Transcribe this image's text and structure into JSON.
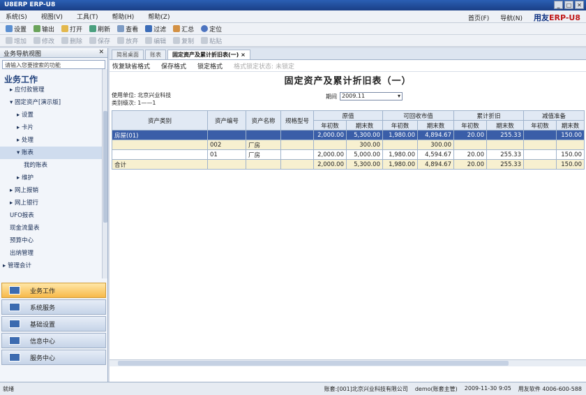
{
  "window": {
    "title": "U8ERP ERP-U8"
  },
  "menu": [
    "系统(S)",
    "视图(V)",
    "工具(T)",
    "帮助(H)",
    "帮助(Z)"
  ],
  "menu_right": {
    "home": "首页(F)",
    "nav": "导航(N)",
    "brand_prefix": "用友",
    "brand": "ERP-U8"
  },
  "toolbar1": [
    "设置",
    "输出",
    "打开",
    "刷新",
    "查看",
    "过滤",
    "汇总",
    "定位"
  ],
  "toolbar2": [
    "增加",
    "修改",
    "删除",
    "保存",
    "放弃",
    "编辑",
    "复制",
    "粘贴"
  ],
  "sidebar": {
    "header": "业务导航视图",
    "search_placeholder": "请输入您要搜索的功能",
    "section_title": "业务工作",
    "tree": [
      {
        "label": "▸ 应付款管理",
        "indent": 1
      },
      {
        "label": "▾ 固定资产[演示版]",
        "indent": 1
      },
      {
        "label": "▸ 设置",
        "indent": 2
      },
      {
        "label": "▸ 卡片",
        "indent": 2
      },
      {
        "label": "▸ 处理",
        "indent": 2
      },
      {
        "label": "▾ 账表",
        "indent": 2
      },
      {
        "label": "我的账表",
        "indent": 3
      },
      {
        "label": "▸ 维护",
        "indent": 2
      },
      {
        "label": "▸ 网上报销",
        "indent": 1
      },
      {
        "label": "▸ 网上银行",
        "indent": 1
      },
      {
        "label": "UFO报表",
        "indent": 1
      },
      {
        "label": "现金流量表",
        "indent": 1
      },
      {
        "label": "预算中心",
        "indent": 1
      },
      {
        "label": "出纳管理",
        "indent": 1
      },
      {
        "label": "▸ 管理会计",
        "indent": 0
      }
    ],
    "nav_buttons": [
      "业务工作",
      "系统服务",
      "基础设置",
      "信息中心",
      "服务中心"
    ]
  },
  "tabs": [
    "简易桌面",
    "账表",
    "固定资产及累计折旧表(一)"
  ],
  "report_tools": [
    "恢复缺省格式",
    "保存格式",
    "锁定格式",
    "格式锁定状态: 未锁定"
  ],
  "report": {
    "title": "固定资产及累计折旧表（一）",
    "unit_label": "使用单位: 北京兴业科技",
    "dept_label": "类别级次: 1——1",
    "period_label": "期间",
    "period_value": "2009.11",
    "headers_row1": [
      "资产类别",
      "资产编号",
      "资产名称",
      "规格型号",
      "原值",
      "可回收市值",
      "累计折旧",
      "减值准备"
    ],
    "headers_row2": [
      "年初数",
      "期末数",
      "年初数",
      "期末数",
      "年初数",
      "期末数",
      "年初数",
      "期末数"
    ],
    "rows": [
      {
        "cells": [
          "房屋(01)",
          "",
          "",
          "",
          "2,000.00",
          "5,300.00",
          "1,980.00",
          "4,894.67",
          "20.00",
          "255.33",
          "",
          "150.00"
        ],
        "style": "sel"
      },
      {
        "cells": [
          "",
          "002",
          "厂房",
          "",
          "",
          "300.00",
          "",
          "300.00",
          "",
          "",
          "",
          ""
        ],
        "style": "yel"
      },
      {
        "cells": [
          "",
          "01",
          "厂房",
          "",
          "2,000.00",
          "5,000.00",
          "1,980.00",
          "4,594.67",
          "20.00",
          "255.33",
          "",
          "150.00"
        ],
        "style": "wht"
      },
      {
        "cells": [
          "合计",
          "",
          "",
          "",
          "2,000.00",
          "5,300.00",
          "1,980.00",
          "4,894.67",
          "20.00",
          "255.33",
          "",
          "150.00"
        ],
        "style": "yel"
      }
    ]
  },
  "status": {
    "left": "就绪",
    "account": "账套:[001]北京兴业科技有限公司",
    "user": "demo(账套主管)",
    "date": "2009-11-30 9:05",
    "hotline": "用友软件 4006-600-588"
  }
}
